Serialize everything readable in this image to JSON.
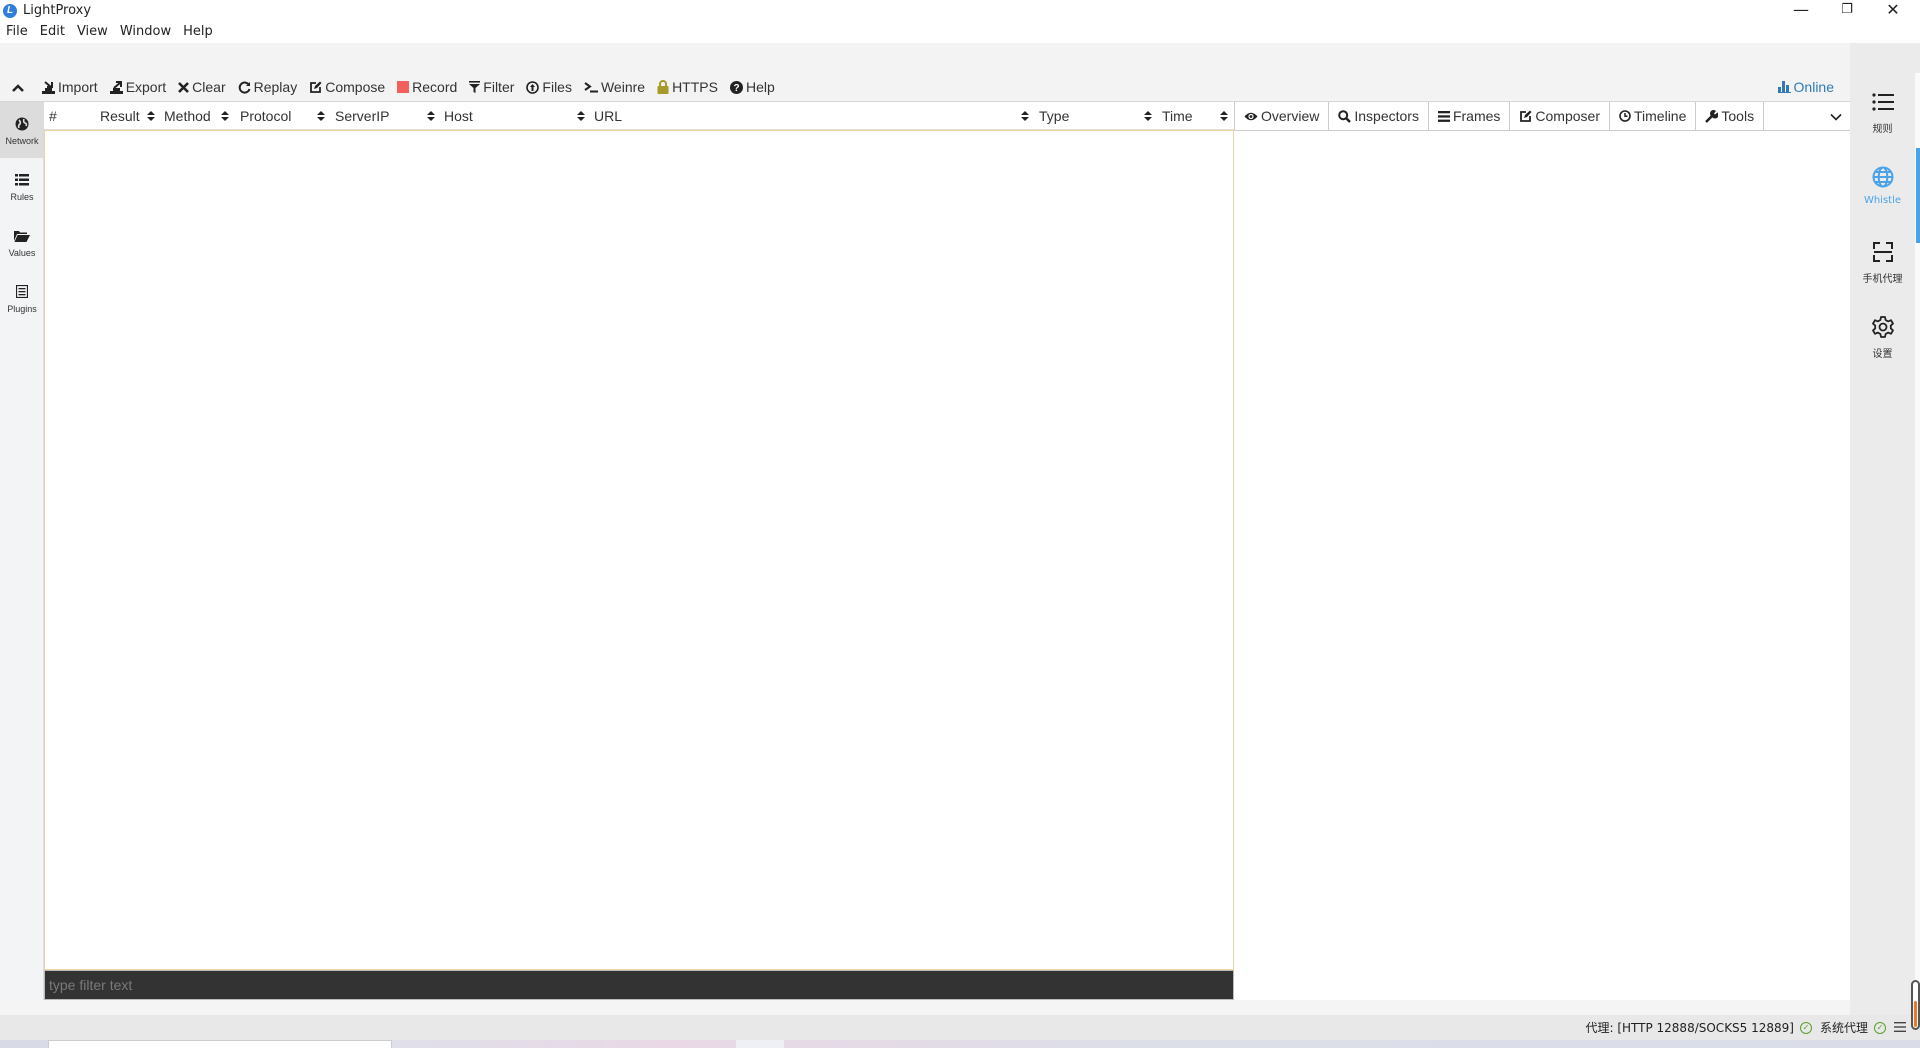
{
  "window": {
    "title": "LightProxy",
    "app_icon_letter": "L",
    "controls": {
      "minimize": "—",
      "restore": "❐",
      "close": "✕"
    }
  },
  "menubar": [
    "File",
    "Edit",
    "View",
    "Window",
    "Help"
  ],
  "toolbar": {
    "collapse_icon": "chevron-up-icon",
    "buttons": [
      {
        "label": "Import",
        "icon": "import-icon"
      },
      {
        "label": "Export",
        "icon": "export-icon"
      },
      {
        "label": "Clear",
        "icon": "close-icon"
      },
      {
        "label": "Replay",
        "icon": "refresh-icon"
      },
      {
        "label": "Compose",
        "icon": "edit-icon"
      },
      {
        "label": "Record",
        "icon": "record-icon"
      },
      {
        "label": "Filter",
        "icon": "filter-icon"
      },
      {
        "label": "Files",
        "icon": "upload-icon"
      },
      {
        "label": "Weinre",
        "icon": "terminal-icon"
      },
      {
        "label": "HTTPS",
        "icon": "lock-icon"
      },
      {
        "label": "Help",
        "icon": "help-icon"
      }
    ],
    "online_label": "Online",
    "colors": {
      "record": "#f25f5c",
      "https_lock": "#a59a2a",
      "online": "#337ab7"
    }
  },
  "left_sidebar": {
    "items": [
      {
        "label": "Network",
        "icon": "globe-icon",
        "active": true
      },
      {
        "label": "Rules",
        "icon": "list-icon",
        "active": false
      },
      {
        "label": "Values",
        "icon": "folder-open-icon",
        "active": false
      },
      {
        "label": "Plugins",
        "icon": "plugin-list-icon",
        "active": false
      }
    ]
  },
  "network": {
    "columns": [
      "#",
      "Result",
      "Method",
      "Protocol",
      "ServerIP",
      "Host",
      "URL",
      "Type",
      "Time"
    ],
    "rows": [],
    "filter_placeholder": "type filter text",
    "filter_value": ""
  },
  "details": {
    "tabs": [
      {
        "label": "Overview",
        "icon": "eye-icon"
      },
      {
        "label": "Inspectors",
        "icon": "search-icon"
      },
      {
        "label": "Frames",
        "icon": "bars-icon"
      },
      {
        "label": "Composer",
        "icon": "edit-icon"
      },
      {
        "label": "Timeline",
        "icon": "clock-icon"
      },
      {
        "label": "Tools",
        "icon": "wrench-icon"
      }
    ]
  },
  "right_sidebar": {
    "items": [
      {
        "label": "规则",
        "icon": "list-icon",
        "active": false
      },
      {
        "label": "Whistle",
        "icon": "globe-icon",
        "active": true
      },
      {
        "label": "手机代理",
        "icon": "scan-icon",
        "active": false
      },
      {
        "label": "设置",
        "icon": "gear-icon",
        "active": false
      }
    ],
    "accent": "#4aa3e8"
  },
  "statusbar": {
    "proxy_text": "代理: [HTTP 12888/SOCKS5 12889]",
    "system_proxy_text": "系统代理",
    "ok_color": "#5aa02c"
  },
  "gauge": {
    "level": 0.6,
    "color": "#f07820"
  }
}
